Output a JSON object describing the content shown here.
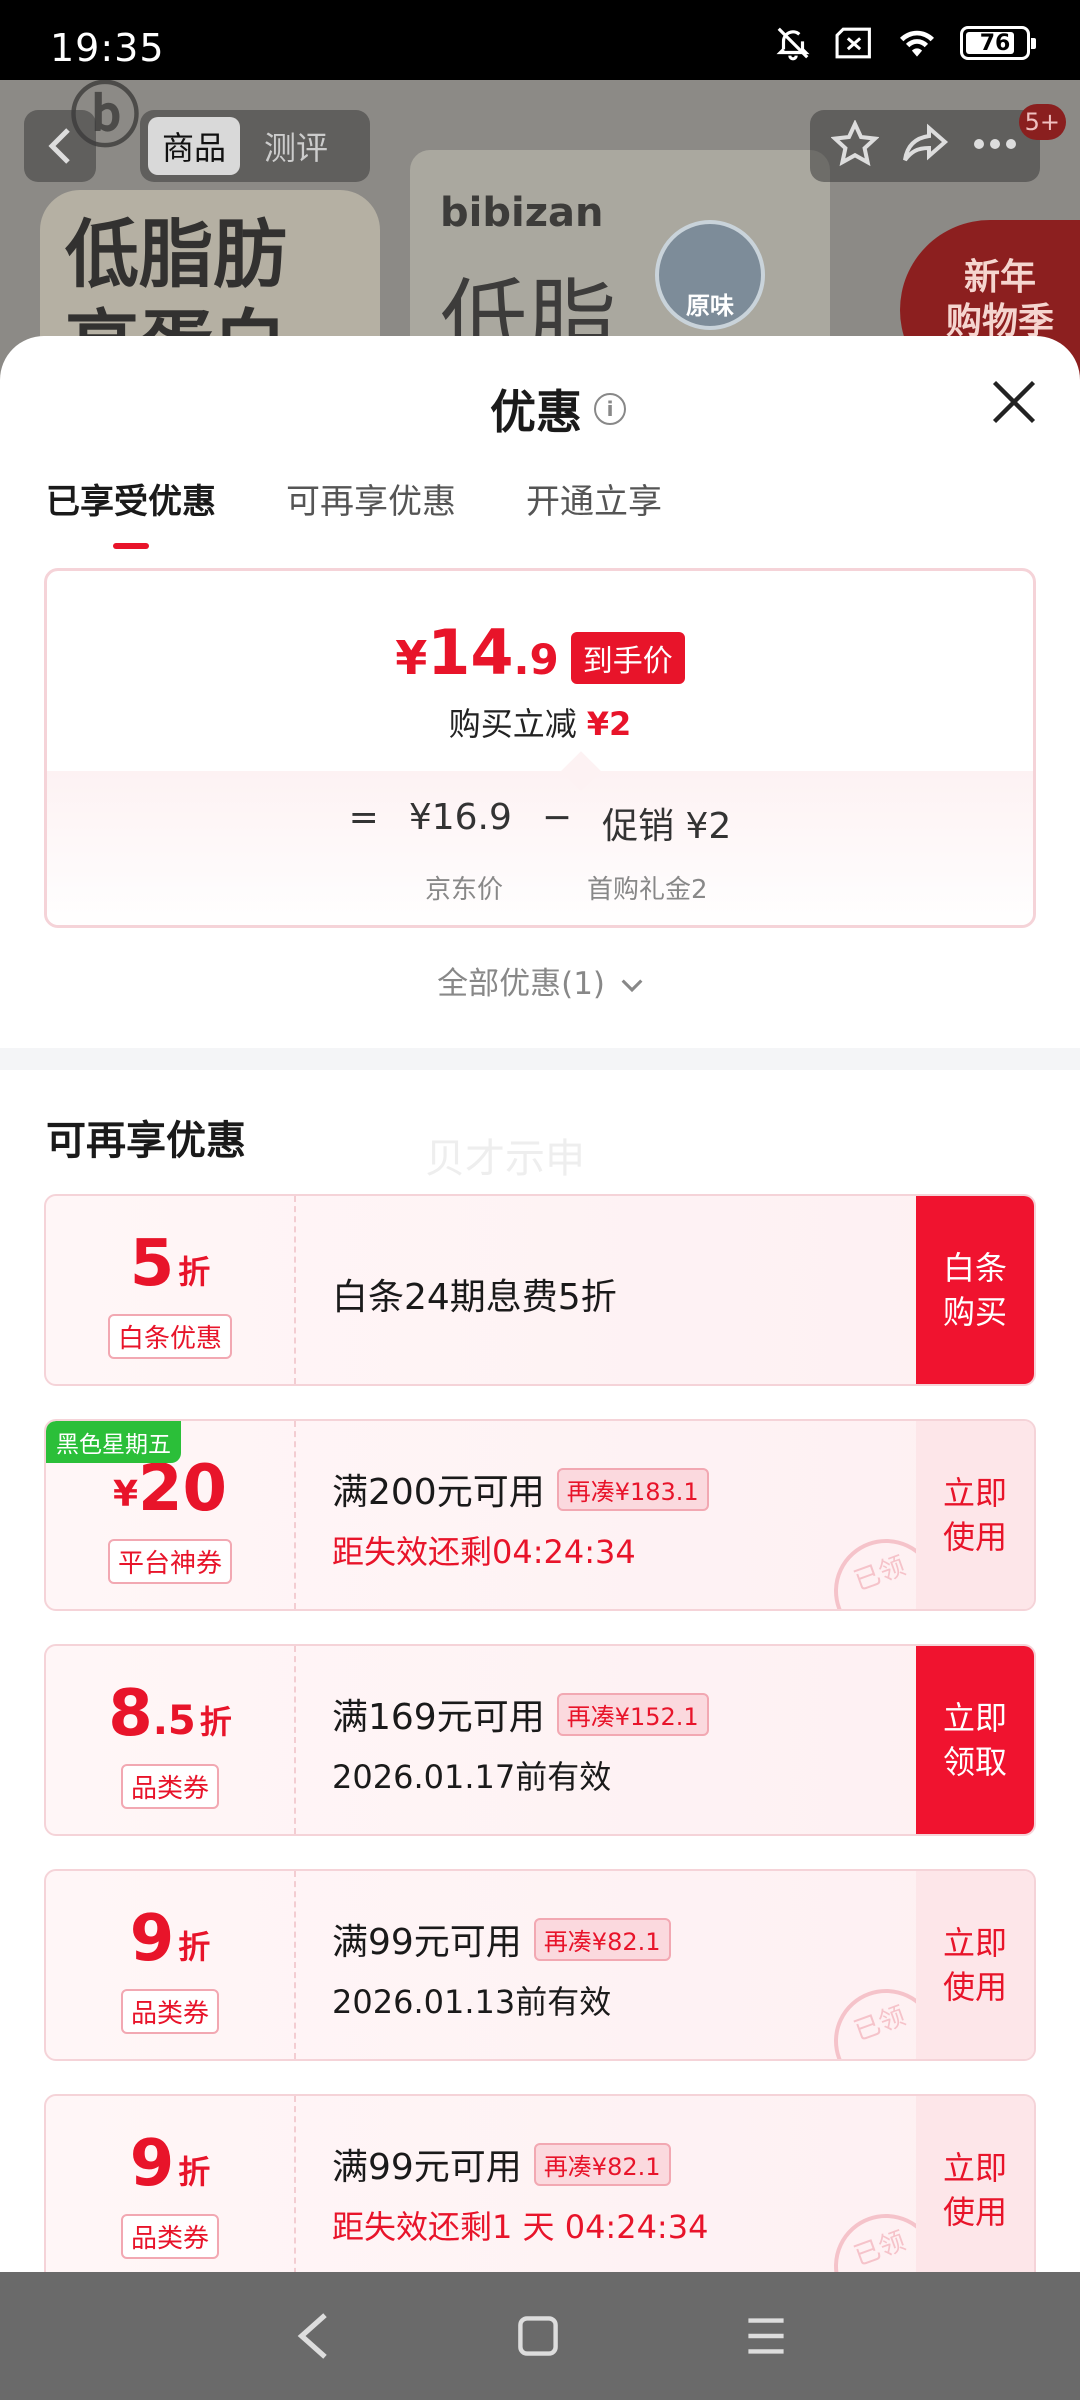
{
  "status_bar": {
    "time": "19:35",
    "battery": "76"
  },
  "background": {
    "tabs": [
      "商品",
      "测评"
    ],
    "brand": "bibizan",
    "product_text": "低脂肪\n高蛋白",
    "pack_text": "低脂",
    "seal_text": "原味",
    "promo_banner": "新年\n购物季",
    "badge": "5+"
  },
  "sheet": {
    "title": "优惠",
    "tabs": [
      "已享受优惠",
      "可再享优惠",
      "开通立享"
    ],
    "price": {
      "currency": "¥",
      "integer": "14",
      "decimal": ".9",
      "badge": "到手价",
      "reduce_label": "购买立减",
      "reduce_value": "¥2",
      "formula_eq": "=",
      "jd_price": "¥16.9",
      "minus": "−",
      "promo": "促销 ¥2",
      "jd_price_label": "京东价",
      "promo_label": "首购礼金2"
    },
    "all_offers": "全部优惠(1)",
    "section_title": "可再享优惠",
    "watermark": "贝才示申"
  },
  "coupons": [
    {
      "value": "5",
      "unit": "折",
      "tag": "白条优惠",
      "desc": "白条24期息费5折",
      "action": "白条\n购买"
    },
    {
      "corner": "黑色星期五",
      "yen": "¥",
      "value": "20",
      "tag": "平台神券",
      "desc": "满200元可用",
      "topup": "再凑¥183.1",
      "sub": "距失效还剩04:24:34",
      "action": "立即\n使用",
      "stamp": "已领"
    },
    {
      "value": "8",
      "small": ".5",
      "unit": "折",
      "tag": "品类券",
      "desc": "满169元可用",
      "topup": "再凑¥152.1",
      "sub": "2026.01.17前有效",
      "action": "立即\n领取"
    },
    {
      "value": "9",
      "unit": "折",
      "tag": "品类券",
      "desc": "满99元可用",
      "topup": "再凑¥82.1",
      "sub": "2026.01.13前有效",
      "action": "立即\n使用",
      "stamp": "已领"
    },
    {
      "value": "9",
      "unit": "折",
      "tag": "品类券",
      "desc": "满99元可用",
      "topup": "再凑¥82.1",
      "sub": "距失效还剩1 天 04:24:34",
      "action": "立即\n使用",
      "stamp": "已领"
    }
  ],
  "colors": {
    "accent": "#e8142a",
    "corner_label": "#2bbf39"
  }
}
